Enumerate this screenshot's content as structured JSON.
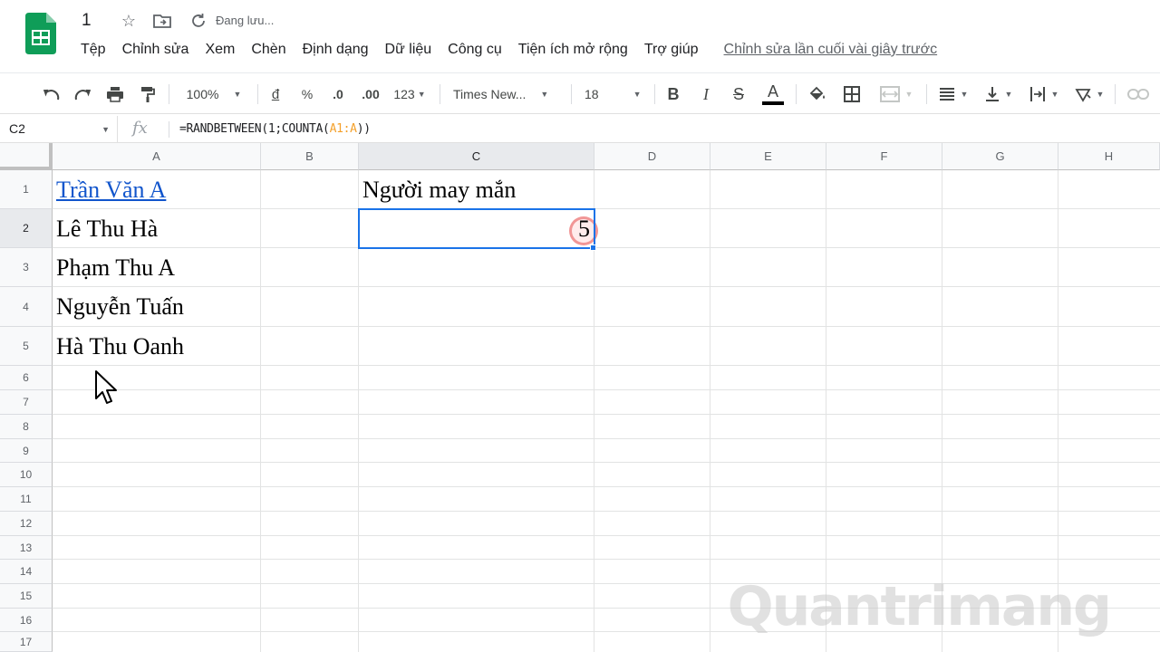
{
  "app": {
    "doc_title": "1",
    "save_status": "Đang lưu...",
    "last_edit": "Chỉnh sửa lần cuối vài giây trước",
    "brand_color": "#0f9d58"
  },
  "menu": [
    "Tệp",
    "Chỉnh sửa",
    "Xem",
    "Chèn",
    "Định dạng",
    "Dữ liệu",
    "Công cụ",
    "Tiện ích mở rộng",
    "Trợ giúp"
  ],
  "toolbar": {
    "zoom": "100%",
    "currency": "đ",
    "percent": "%",
    "dec_decrease": ".0",
    "dec_increase": ".00",
    "format_more": "123",
    "font": "Times New...",
    "font_size": "18",
    "bold": "B",
    "italic": "I",
    "strike": "S",
    "text_color": "A",
    "text_color_value": "#000000"
  },
  "formula_bar": {
    "name_box": "C2",
    "fx": "fx",
    "formula_prefix": "=RANDBETWEEN(1;COUNTA(",
    "formula_ref": "A1:A",
    "formula_suffix": "))"
  },
  "columns": [
    "A",
    "B",
    "C",
    "D",
    "E",
    "F",
    "G",
    "H"
  ],
  "rows": [
    "1",
    "2",
    "3",
    "4",
    "5",
    "6",
    "7",
    "8",
    "9",
    "10",
    "11",
    "12",
    "13",
    "14",
    "15",
    "16",
    "17"
  ],
  "cells": {
    "A1": "Trần Văn A",
    "A2": "Lê Thu Hà",
    "A3": "Phạm Thu A",
    "A4": "Nguyễn Tuấn",
    "A5": "Hà Thu Oanh",
    "C1": "Người may mắn",
    "C2": "5"
  },
  "selected_cell": "C2",
  "watermark": "Quantrimang"
}
